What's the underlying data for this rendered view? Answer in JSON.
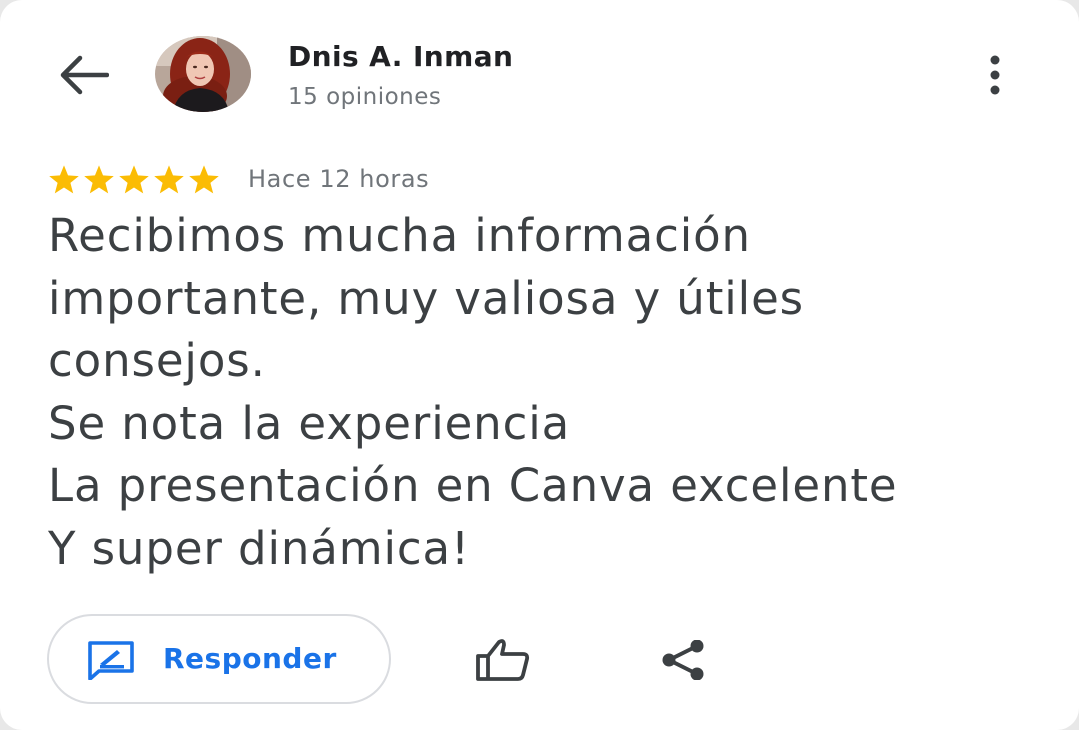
{
  "author": {
    "name": "Dnis A. Inman",
    "review_count": "15 opiniones"
  },
  "review": {
    "rating": 5,
    "rating_max": 5,
    "time": "Hace 12 horas",
    "lines": [
      "Recibimos mucha información",
      "importante, muy valiosa y útiles",
      "consejos.",
      "Se nota la experiencia",
      "La presentación en Canva excelente",
      "Y super dinámica!"
    ]
  },
  "actions": {
    "reply_label": "Responder",
    "like_icon": "thumb-up-icon",
    "share_icon": "share-icon",
    "back_icon": "arrow-back-icon",
    "more_icon": "more-vert-icon"
  },
  "colors": {
    "star": "#fbbc04",
    "accent": "#1a73e8",
    "text_primary": "#3c4043",
    "text_secondary": "#70757a"
  }
}
